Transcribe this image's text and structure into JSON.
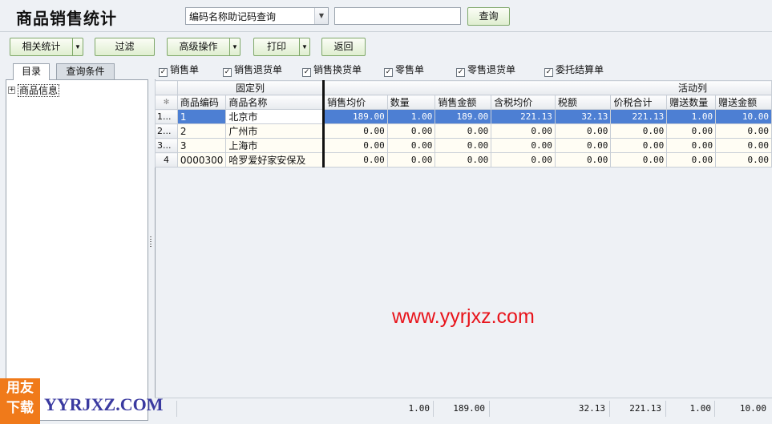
{
  "header": {
    "title": "商品销售统计",
    "query_select_value": "编码名称助记码查询",
    "search_value": "",
    "query_button": "查询"
  },
  "toolbar": {
    "related_stats": "相关统计",
    "filter": "过滤",
    "advanced": "高级操作",
    "print": "打印",
    "back": "返回"
  },
  "left_panel": {
    "tabs": [
      "目录",
      "查询条件"
    ],
    "tree_root": "商品信息"
  },
  "filters": [
    {
      "label": "销售单",
      "checked": true
    },
    {
      "label": "销售退货单",
      "checked": true
    },
    {
      "label": "销售换货单",
      "checked": true
    },
    {
      "label": "零售单",
      "checked": true
    },
    {
      "label": "零售退货单",
      "checked": true
    },
    {
      "label": "委托结算单",
      "checked": true
    }
  ],
  "grid": {
    "group_fixed": "固定列",
    "group_active": "活动列",
    "corner": "✻",
    "columns": [
      "商品编码",
      "商品名称",
      "销售均价",
      "数量",
      "销售金额",
      "含税均价",
      "税额",
      "价税合计",
      "赠送数量",
      "赠送金额"
    ],
    "rows": [
      {
        "rownum": "1...",
        "code": "1",
        "name": "北京市",
        "avg_price": "189.00",
        "qty": "1.00",
        "amount": "189.00",
        "tax_avg": "221.13",
        "tax": "32.13",
        "total": "221.13",
        "gift_qty": "1.00",
        "gift_amt": "10.00"
      },
      {
        "rownum": "2...",
        "code": "2",
        "name": "广州市",
        "avg_price": "0.00",
        "qty": "0.00",
        "amount": "0.00",
        "tax_avg": "0.00",
        "tax": "0.00",
        "total": "0.00",
        "gift_qty": "0.00",
        "gift_amt": "0.00"
      },
      {
        "rownum": "3...",
        "code": "3",
        "name": "上海市",
        "avg_price": "0.00",
        "qty": "0.00",
        "amount": "0.00",
        "tax_avg": "0.00",
        "tax": "0.00",
        "total": "0.00",
        "gift_qty": "0.00",
        "gift_amt": "0.00"
      },
      {
        "rownum": "4",
        "code": "0000300",
        "name": "哈罗爱好家安保及",
        "avg_price": "0.00",
        "qty": "0.00",
        "amount": "0.00",
        "tax_avg": "0.00",
        "tax": "0.00",
        "total": "0.00",
        "gift_qty": "0.00",
        "gift_amt": "0.00"
      }
    ]
  },
  "totals": {
    "qty": "1.00",
    "amount": "189.00",
    "tax": "32.13",
    "total": "221.13",
    "gift_qty": "1.00",
    "gift_amt": "10.00"
  },
  "watermark": {
    "url": "www.yyrjxz.com",
    "logo_line1": "用友",
    "logo_line2": "下载",
    "logo_text": "YYRJXZ.COM"
  },
  "colors": {
    "selected_row": "#4d7fd3",
    "watermark_red": "#e8141b",
    "logo_orange": "#f07a1a",
    "button_green": "#dfeed0"
  }
}
